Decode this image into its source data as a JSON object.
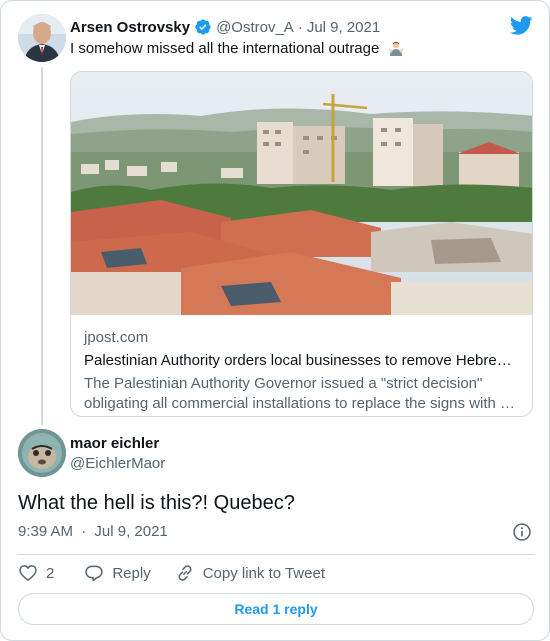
{
  "colors": {
    "accent": "#1d9bf0",
    "text": "#0f1419",
    "muted": "#536471",
    "border": "#cfd9de"
  },
  "quoted_tweet": {
    "author_name": "Arsen Ostrovsky",
    "verified_icon": "verified-badge-icon",
    "handle": "@Ostrov_A",
    "separator": "·",
    "date": "Jul 9, 2021",
    "text": "I somehow missed all the international outrage",
    "emoji_icon": "man-shrugging-emoji"
  },
  "link_card": {
    "image_alt": "Hillside town with red-roofed buildings and construction crane",
    "domain": "jpost.com",
    "title": "Palestinian Authority orders local businesses to remove Hebre…",
    "description_line1": "The Palestinian Authority Governor issued a \"strict decision\"",
    "description_line2": "obligating all commercial installations to replace the signs with …"
  },
  "main_tweet": {
    "author_name": "maor eichler",
    "handle": "@EichlerMaor",
    "text": "What the hell is this?! Quebec?",
    "time": "9:39 AM",
    "separator": "·",
    "date": "Jul 9, 2021"
  },
  "actions": {
    "like_count": "2",
    "reply_label": "Reply",
    "copy_link_label": "Copy link to Tweet"
  },
  "read_replies_label": "Read 1 reply"
}
